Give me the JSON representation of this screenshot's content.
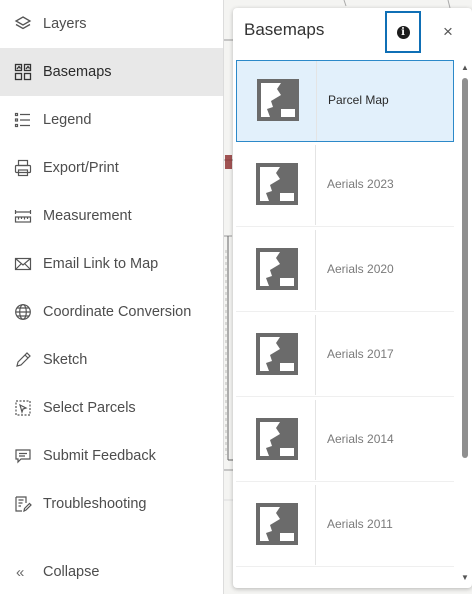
{
  "sidebar": {
    "items": [
      {
        "label": "Layers",
        "icon": "layers-icon"
      },
      {
        "label": "Basemaps",
        "icon": "basemap-gallery-icon",
        "active": true
      },
      {
        "label": "Legend",
        "icon": "legend-icon"
      },
      {
        "label": "Export/Print",
        "icon": "print-icon"
      },
      {
        "label": "Measurement",
        "icon": "measure-icon"
      },
      {
        "label": "Email Link to Map",
        "icon": "envelope-icon"
      },
      {
        "label": "Coordinate Conversion",
        "icon": "globe-icon"
      },
      {
        "label": "Sketch",
        "icon": "pencil-icon"
      },
      {
        "label": "Select Parcels",
        "icon": "select-icon"
      },
      {
        "label": "Submit Feedback",
        "icon": "speech-bubble-icon"
      },
      {
        "label": "Troubleshooting",
        "icon": "checklist-pencil-icon"
      }
    ],
    "collapse_label": "Collapse",
    "collapse_icon": "«"
  },
  "basemaps_panel": {
    "title": "Basemaps",
    "info_icon": "i",
    "close_icon": "×",
    "items": [
      {
        "label": "Parcel Map",
        "selected": true
      },
      {
        "label": "Aerials 2023"
      },
      {
        "label": "Aerials 2020"
      },
      {
        "label": "Aerials 2017"
      },
      {
        "label": "Aerials 2014"
      },
      {
        "label": "Aerials 2011"
      }
    ]
  },
  "colors": {
    "active_nav_bg": "#e8e8e8",
    "selected_item_bg": "#e2f0fb",
    "selected_item_border": "#2c89c9",
    "info_button_border": "#0f6fb5",
    "thumbnail_fill": "#6b6b6b"
  }
}
